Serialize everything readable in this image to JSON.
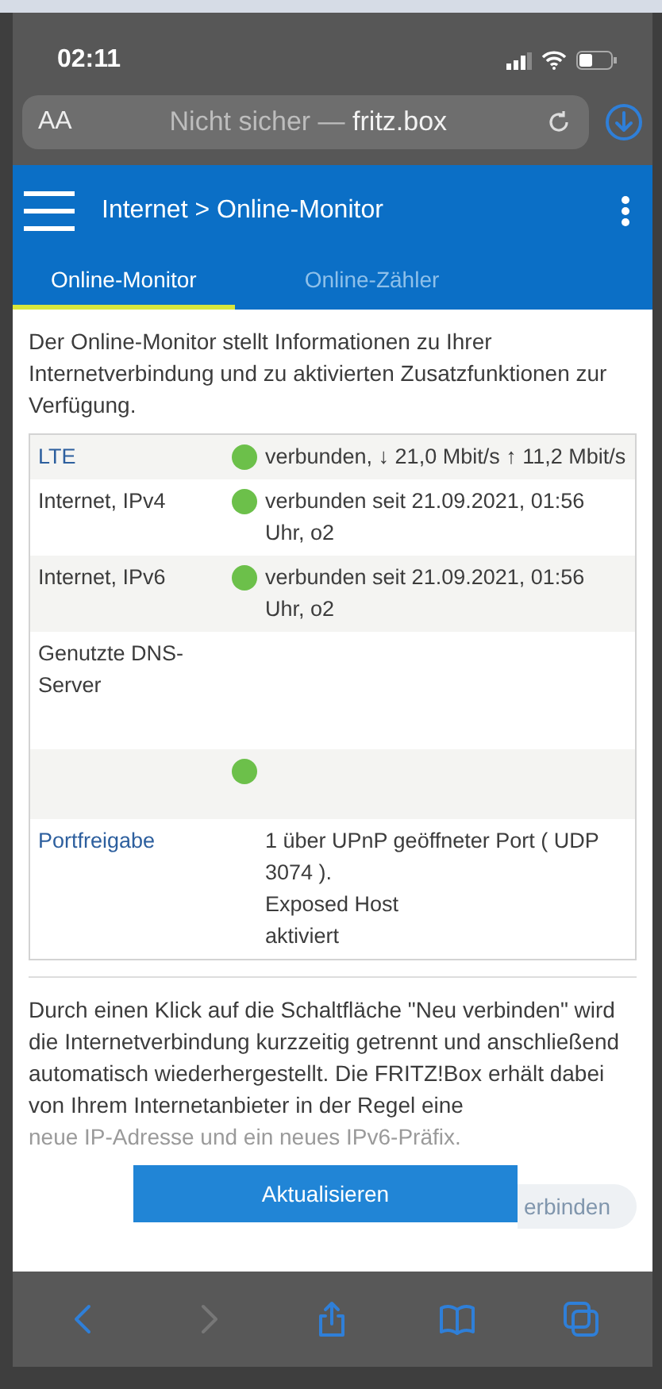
{
  "status_bar": {
    "time": "02:11"
  },
  "address_bar": {
    "text_size_button": "AA",
    "security": "Nicht sicher —",
    "host": "fritz.box"
  },
  "header": {
    "breadcrumb": "Internet > Online-Monitor"
  },
  "tabs": [
    {
      "label": "Online-Monitor",
      "selected": true
    },
    {
      "label": "Online-Zähler",
      "selected": false
    }
  ],
  "intro": "Der Online-Monitor stellt Informationen zu Ihrer Internetverbindung und zu aktivierten Zusatzfunktionen zur Verfügung.",
  "rows": [
    {
      "kind": "link",
      "label": "LTE",
      "color": "#6cc04a",
      "values": [
        "verbunden, ↓ 21,0 Mbit/s ↑ 11,2 Mbit/s"
      ]
    },
    {
      "kind": "text",
      "label": "Internet, IPv4",
      "color": "#6cc04a",
      "values": [
        "verbunden seit 21.09.2021, 01:56 Uhr, o2"
      ]
    },
    {
      "kind": "text",
      "label": "Internet, IPv6",
      "color": "#6cc04a",
      "values": [
        "verbunden seit 21.09.2021, 01:56 Uhr, o2"
      ]
    },
    {
      "kind": "text",
      "label": "Genutzte DNS-Server",
      "values": []
    },
    {
      "color": "#6cc04a",
      "values": []
    },
    {
      "kind": "link",
      "label": "Portfreigabe",
      "values": [
        "1 über UPnP geöffneter Port ( UDP 3074 ).",
        "Exposed Host",
        "aktiviert"
      ]
    }
  ],
  "explanation": "Durch einen Klick auf die Schaltfläche \"Neu verbinden\" wird die Internetverbindung kurzzeitig getrennt und anschließend automatisch wiederhergestellt. Die FRITZ!Box erhält dabei von Ihrem Internetanbieter in der Regel eine",
  "explanation_faded": "neue IP-Adresse und ein neues IPv6-Präfix.",
  "buttons": [
    {
      "label": "Aktualisieren",
      "kind": "primary"
    },
    {
      "label": "erbinden",
      "kind": "faded"
    }
  ]
}
